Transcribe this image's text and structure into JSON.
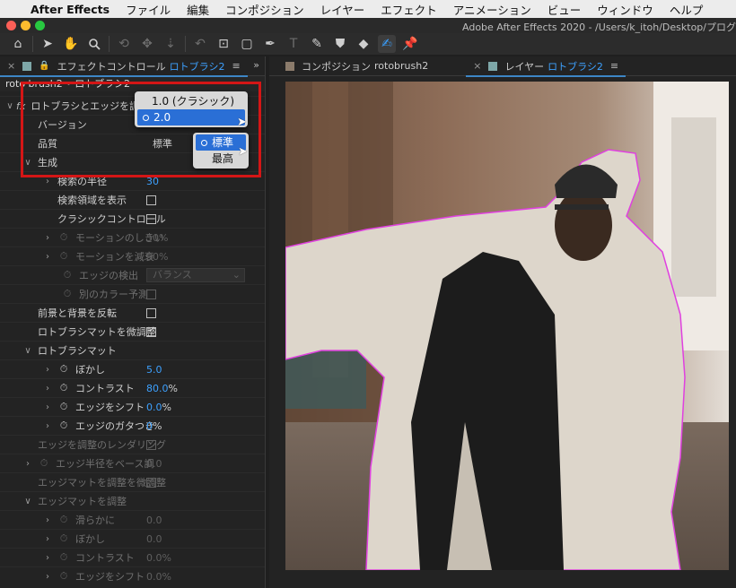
{
  "menubar": {
    "app_name": "After Effects",
    "items": [
      "ファイル",
      "編集",
      "コンポジション",
      "レイヤー",
      "エフェクト",
      "アニメーション",
      "ビュー",
      "ウィンドウ",
      "ヘルプ"
    ]
  },
  "window": {
    "title": "Adobe After Effects 2020 - /Users/k_itoh/Desktop/プログ"
  },
  "toolbar": {
    "icons": [
      "home-icon",
      "selection-arrow-icon",
      "hand-icon",
      "zoom-icon",
      "orbit-camera-icon",
      "pan-camera-icon",
      "dolly-camera-icon",
      "rotate-icon",
      "anchor-point-icon",
      "rectangle-icon",
      "pen-icon",
      "type-icon",
      "brush-icon",
      "clone-stamp-icon",
      "eraser-icon",
      "roto-brush-icon",
      "puppet-pin-icon"
    ]
  },
  "left_panel": {
    "tab": {
      "close": "×",
      "label": "エフェクトコントロール",
      "layer": "ロトブラシ2",
      "menu": "≡"
    },
    "breadcrumb": "roto brush2 • ロトブラシ2",
    "fx_label": "fx",
    "rows": {
      "effect_name": "ロトブラシとエッジを調整",
      "version": "バージョン",
      "quality": "品質",
      "quality_value": "標準",
      "generate": "生成",
      "search_radius": "検索の半径",
      "search_radius_val": "30",
      "show_search_region": "検索領域を表示",
      "classic_control": "クラシックコントロール",
      "motion_threshold": "モーションのしきい",
      "motion_threshold_val": "50%",
      "motion_damping": "モーションを減衰",
      "motion_damping_val": "50%",
      "edge_detection": "エッジの検出",
      "edge_detection_val": "バランス",
      "alt_color": "別のカラー予測",
      "invert_fg_bg": "前景と背景を反転",
      "refine_roto_matte": "ロトブラシマットを微調整",
      "roto_matte": "ロトブラシマット",
      "feather": "ぼかし",
      "feather_val": "5.0",
      "contrast": "コントラスト",
      "contrast_val": "80.0",
      "contrast_unit": "%",
      "shift_edge": "エッジをシフト",
      "shift_edge_val": "0.0",
      "shift_edge_unit": "%",
      "reduce_chatter": "エッジのガタつき",
      "reduce_chatter_val": "0",
      "reduce_chatter_unit": "%",
      "render_refine_edge": "エッジを調整のレンダリング",
      "base_edge_radius": "エッジ半径をベース調",
      "base_edge_radius_val": "0.0",
      "refine_edge_matte": "エッジマットを調整を微調整",
      "edge_matte": "エッジマットを調整",
      "smooth": "滑らかに",
      "smooth_val": "0.0",
      "feather2": "ぼかし",
      "feather2_val": "0.0",
      "contrast2": "コントラスト",
      "contrast2_val": "0.0%",
      "shift_edge2": "エッジをシフト",
      "shift_edge2_val": "0.0%"
    },
    "version_popup": {
      "options": [
        "1.0 (クラシック)",
        "2.0"
      ],
      "selected": "2.0"
    },
    "quality_popup": {
      "options": [
        "標準",
        "最高"
      ],
      "selected": "標準"
    }
  },
  "right_panel": {
    "tab_comp": {
      "close": "×",
      "label": "コンポジション",
      "name": "rotobrush2"
    },
    "tab_layer": {
      "close": "×",
      "label": "レイヤー",
      "name": "ロトブラシ2",
      "menu": "≡"
    }
  },
  "colors": {
    "accent": "#3da1ff",
    "highlight_box": "#d41616",
    "roto_outline": "#e040e0"
  }
}
